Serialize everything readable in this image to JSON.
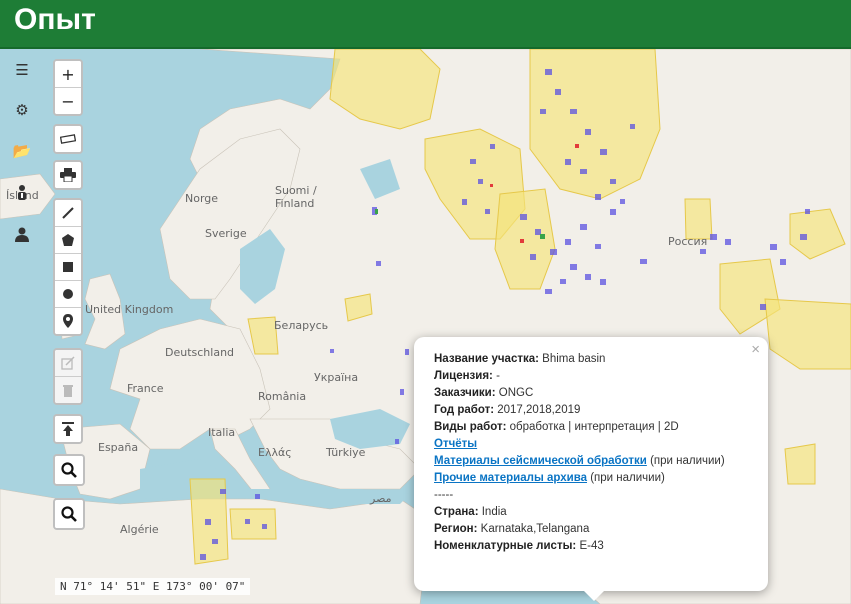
{
  "app": {
    "title": "Опыт"
  },
  "sidebar": {
    "icons": [
      "menu-icon",
      "gear-icon",
      "folder-open-icon",
      "user-info-icon",
      "user-icon"
    ]
  },
  "toolbar": {
    "zoom_in": "+",
    "zoom_out": "−"
  },
  "map_labels": {
    "island": "Ísland",
    "norge": "Norge",
    "suomi": "Suomi /",
    "finland": "Finland",
    "sverige": "Sverige",
    "uk": "United Kingdom",
    "belarus": "Беларусь",
    "deutschland": "Deutschland",
    "ukraina": "Україна",
    "france": "France",
    "romania": "România",
    "italia": "Italia",
    "espana": "España",
    "ellas": "Ελλάς",
    "turkiye": "Türkiye",
    "algerie": "Algérie",
    "misr": "مصر",
    "rossiya": "Россия"
  },
  "popup": {
    "close": "×",
    "area_label": "Название участка:",
    "area_value": "Bhima basin",
    "license_label": "Лицензия:",
    "license_value": "-",
    "customers_label": "Заказчики:",
    "customers_value": "ONGC",
    "year_label": "Год работ:",
    "year_value": "2017,2018,2019",
    "works_label": "Виды работ:",
    "works_value": "обработка | интерпретация | 2D",
    "link_reports": "Отчёты",
    "link_seismic": "Материалы сейсмической обработки",
    "link_seismic_suffix": "(при наличии)",
    "link_other": "Прочие материалы архива",
    "link_other_suffix": "(при наличии)",
    "separator": "-----",
    "country_label": "Страна:",
    "country_value": "India",
    "region_label": "Регион:",
    "region_value": "Karnataka,Telangana",
    "sheets_label": "Номенклатурные листы:",
    "sheets_value": "E-43"
  },
  "coordinates": "N 71° 14' 51\" E 173° 00' 07\"",
  "colors": {
    "header": "#1e7d36",
    "water": "#a9d3df",
    "land": "#f2efe9",
    "area_yellow": "#f5e37a",
    "survey_blue": "#4b3fd6",
    "link": "#0a74c4"
  }
}
